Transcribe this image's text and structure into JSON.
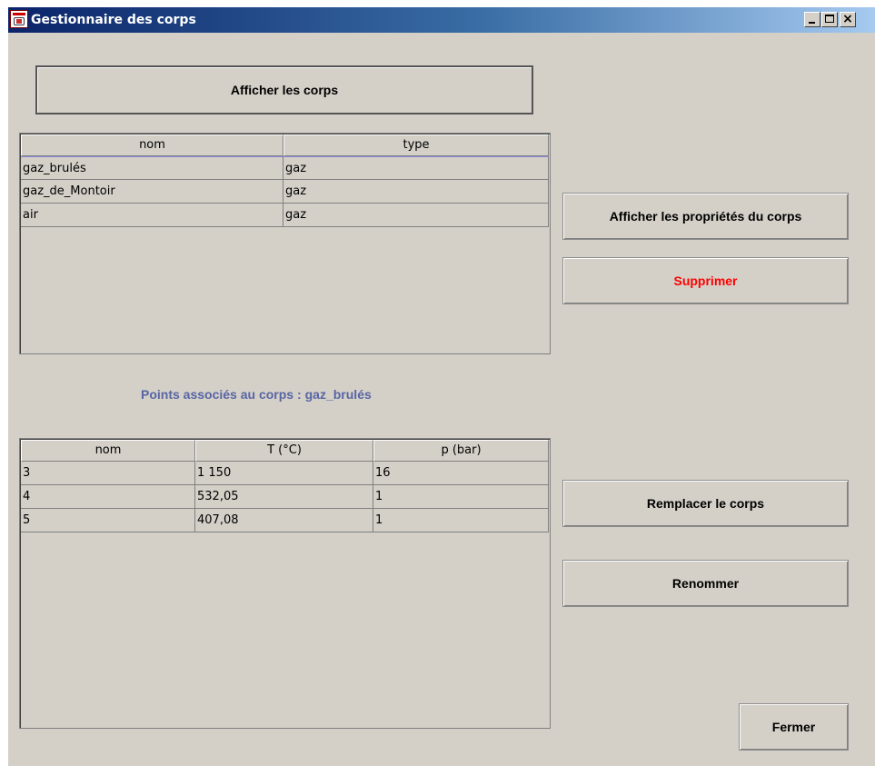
{
  "window": {
    "title": "Gestionnaire des corps",
    "controls": {
      "minimize": "_",
      "maximize": "□",
      "close": "×"
    }
  },
  "buttons": {
    "show_bodies": "Afficher les corps",
    "show_properties": "Afficher les propriétés du corps",
    "delete": "Supprimer",
    "replace": "Remplacer le corps",
    "rename": "Renommer",
    "close": "Fermer"
  },
  "colors": {
    "delete_text": "#ff0000",
    "selected_row": "#ccccff",
    "associated_label": "#5865a4",
    "window_bg": "#d4d0c8"
  },
  "bodies_table": {
    "columns": [
      "nom",
      "type"
    ],
    "rows": [
      {
        "nom": "gaz_brulés",
        "type": "gaz",
        "selected": true
      },
      {
        "nom": "gaz_de_Montoir",
        "type": "gaz",
        "selected": false
      },
      {
        "nom": "air",
        "type": "gaz",
        "selected": false
      }
    ]
  },
  "associated_points": {
    "label": "Points associés au corps :",
    "body": "gaz_brulés"
  },
  "points_table": {
    "columns": [
      "nom",
      "T (°C)",
      "p (bar)"
    ],
    "rows": [
      {
        "nom": "3",
        "t": "1 150",
        "p": "16"
      },
      {
        "nom": "4",
        "t": "532,05",
        "p": "1"
      },
      {
        "nom": "5",
        "t": "407,08",
        "p": "1"
      }
    ]
  }
}
